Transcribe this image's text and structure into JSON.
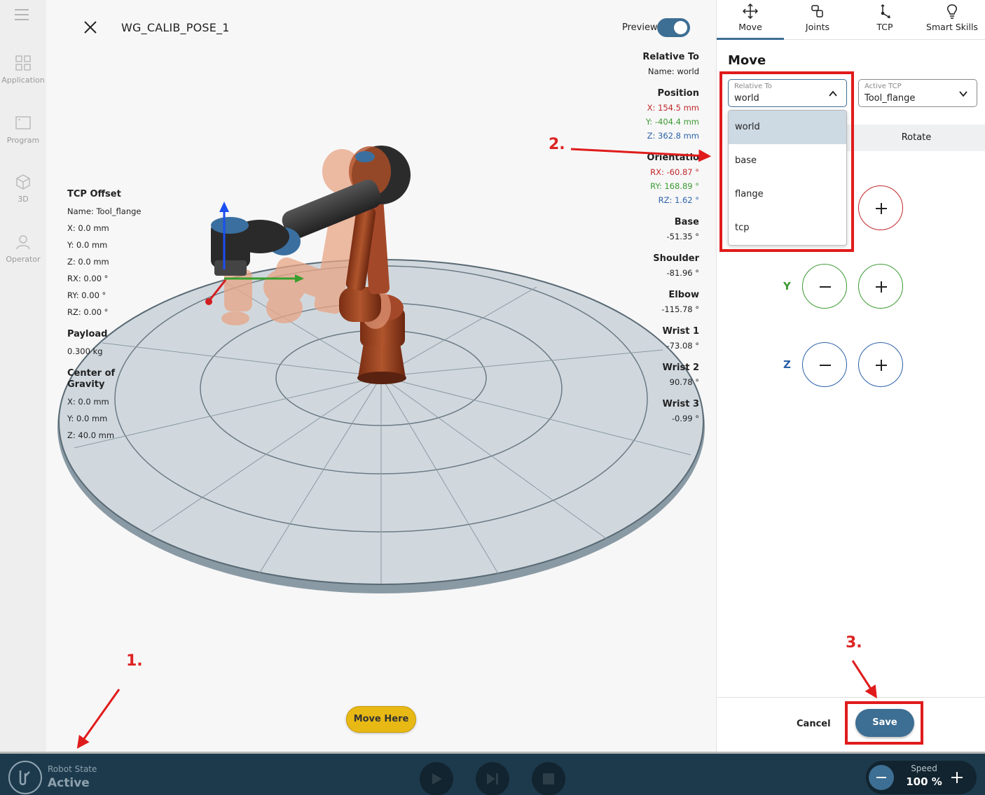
{
  "nav": {
    "items": [
      {
        "label": "Application",
        "icon": "grid-icon"
      },
      {
        "label": "Program",
        "icon": "window-icon"
      },
      {
        "label": "3D",
        "icon": "cube-icon"
      },
      {
        "label": "Operator",
        "icon": "person-icon"
      }
    ]
  },
  "viewport": {
    "pose_name": "WG_CALIB_POSE_1",
    "preview_label": "Preview",
    "preview_on": true,
    "relative_to": {
      "heading": "Relative To",
      "name": "Name: world"
    },
    "position": {
      "heading": "Position",
      "x": "X: 154.5 mm",
      "y": "Y: -404.4 mm",
      "z": "Z: 362.8 mm"
    },
    "orientation": {
      "heading": "Orientatio",
      "rx": "RX: -60.87 °",
      "ry": "RY: 168.89 °",
      "rz": "RZ: 1.62 °"
    },
    "joints": [
      {
        "name": "Base",
        "value": "-51.35 °"
      },
      {
        "name": "Shoulder",
        "value": "-81.96 °"
      },
      {
        "name": "Elbow",
        "value": "-115.78 °"
      },
      {
        "name": "Wrist 1",
        "value": "-73.08 °"
      },
      {
        "name": "Wrist 2",
        "value": "90.78 °"
      },
      {
        "name": "Wrist 3",
        "value": "-0.99 °"
      }
    ],
    "tcp_offset": {
      "heading": "TCP Offset",
      "name": "Name: Tool_flange",
      "x": "X: 0.0 mm",
      "y": "Y: 0.0 mm",
      "z": "Z: 0.0 mm",
      "rx": "RX: 0.00 °",
      "ry": "RY: 0.00 °",
      "rz": "RZ: 0.00 °"
    },
    "payload": {
      "heading": "Payload",
      "value": "0.300 kg"
    },
    "cog": {
      "heading_1": "Center of",
      "heading_2": "Gravity",
      "x": "X: 0.0 mm",
      "y": "Y: 0.0 mm",
      "z": "Z: 40.0 mm"
    },
    "move_here_label": "Move Here"
  },
  "panel": {
    "tabs": [
      {
        "label": "Move",
        "icon": "move-arrows-icon",
        "active": true
      },
      {
        "label": "Joints",
        "icon": "joint-icon",
        "active": false
      },
      {
        "label": "TCP",
        "icon": "tcp-axes-icon",
        "active": false
      },
      {
        "label": "Smart Skills",
        "icon": "lightbulb-icon",
        "active": false
      }
    ],
    "title": "Move",
    "relative_to": {
      "label": "Relative To",
      "value": "world",
      "expanded": true
    },
    "active_tcp": {
      "label": "Active TCP",
      "value": "Tool_flange"
    },
    "segment_rotate": "Rotate",
    "dropdown_options": [
      "world",
      "base",
      "flange",
      "tcp"
    ],
    "dropdown_selected": "world",
    "axes": [
      {
        "label": "Y",
        "color": "#3c9a33"
      },
      {
        "label": "Z",
        "color": "#2c62a8"
      }
    ],
    "x_color": "#c0282a",
    "cancel_label": "Cancel",
    "save_label": "Save"
  },
  "statusbar": {
    "robot_state_label": "Robot State",
    "robot_state_value": "Active",
    "speed_label": "Speed",
    "speed_value": "100 %"
  },
  "annotations": [
    "1.",
    "2.",
    "3."
  ],
  "colors": {
    "accent": "#3d6e93",
    "annotation": "#e01b1b",
    "move_here": "#e8b915"
  }
}
